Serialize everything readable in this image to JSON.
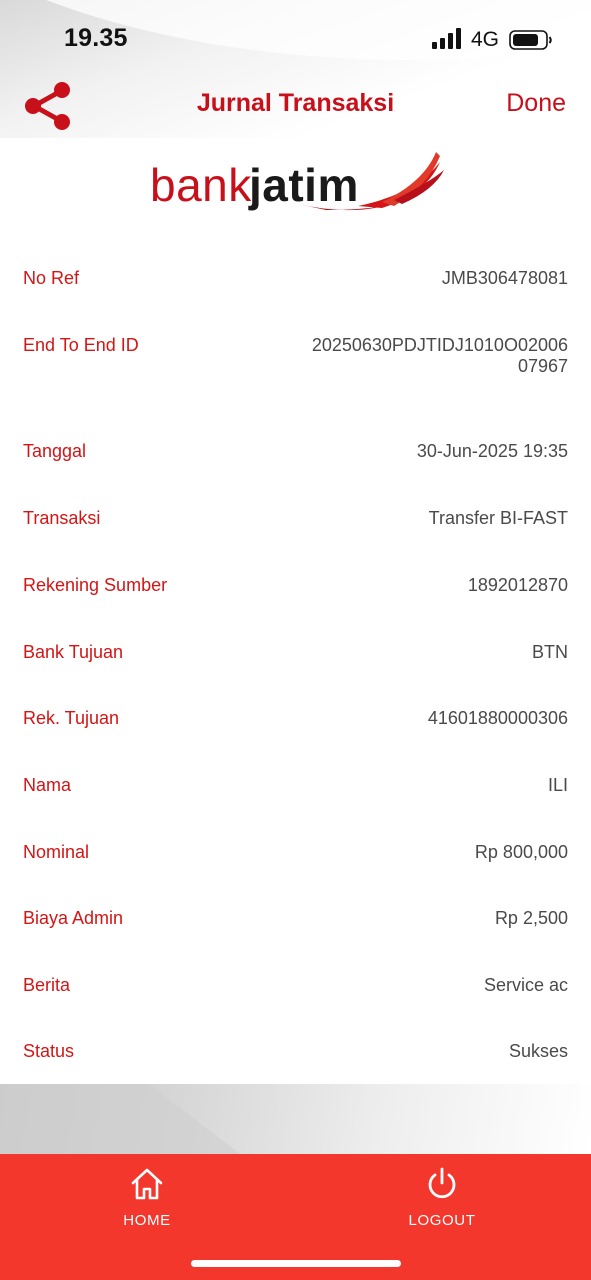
{
  "status_bar": {
    "time": "19.35",
    "network": "4G",
    "icons": [
      "signal-icon",
      "battery-icon"
    ]
  },
  "header": {
    "title": "Jurnal Transaksi",
    "done_label": "Done",
    "share_icon": "share-icon"
  },
  "logo": {
    "text_bank": "bank",
    "text_jatim": "jatim"
  },
  "details": [
    {
      "label": "No Ref",
      "value": "JMB306478081"
    },
    {
      "label": "End To End ID",
      "value": "20250630PDJTIDJ1010O0200607967"
    },
    {
      "label": "Tanggal",
      "value": "30-Jun-2025 19:35"
    },
    {
      "label": "Transaksi",
      "value": "Transfer BI-FAST"
    },
    {
      "label": "Rekening Sumber",
      "value": "1892012870"
    },
    {
      "label": "Bank Tujuan",
      "value": "BTN"
    },
    {
      "label": "Rek. Tujuan",
      "value": "41601880000306"
    },
    {
      "label": "Nama",
      "value": "ILI"
    },
    {
      "label": "Nominal",
      "value": "Rp 800,000"
    },
    {
      "label": "Biaya Admin",
      "value": "Rp 2,500"
    },
    {
      "label": "Berita",
      "value": "Service ac"
    },
    {
      "label": "Status",
      "value": "Sukses"
    }
  ],
  "tab_bar": {
    "home_label": "HOME",
    "logout_label": "LOGOUT",
    "home_icon": "home-icon",
    "logout_icon": "power-icon"
  },
  "colors": {
    "accent_red": "#c8101a",
    "label_red": "#d31515",
    "tab_bar_red": "#f3372d",
    "value_gray": "#4a4a4a"
  }
}
